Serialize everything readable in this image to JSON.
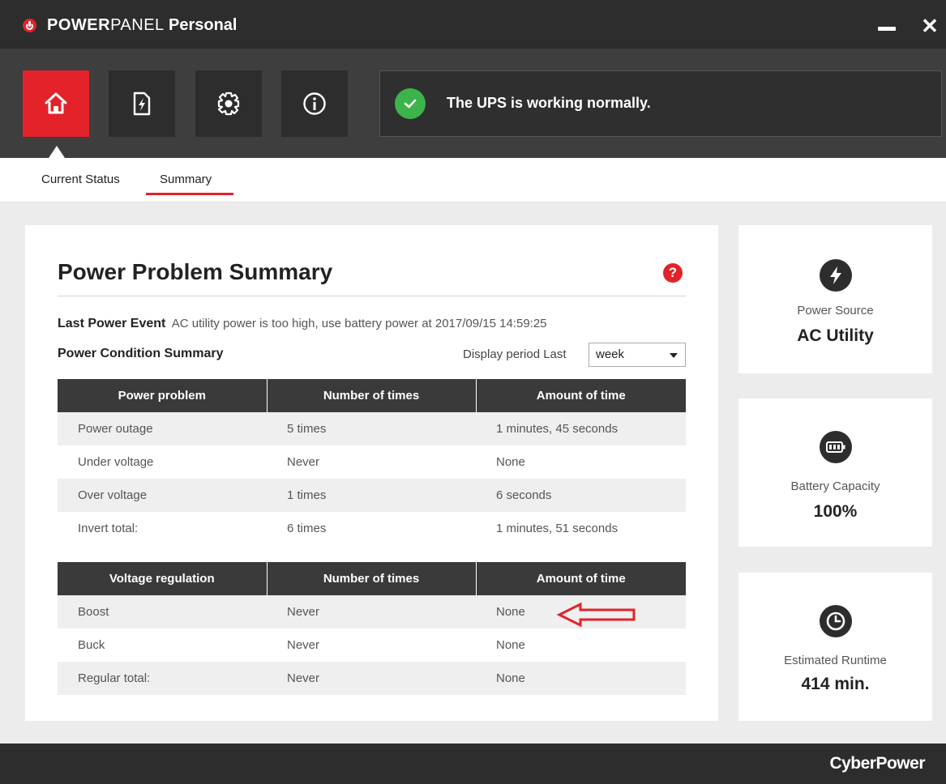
{
  "app": {
    "title_part1": "POWER",
    "title_part2": "PANEL",
    "title_part3": "Personal",
    "accent": "#e3222a"
  },
  "window_controls": {
    "minimize_icon": "minimize-icon",
    "close_label": "✕"
  },
  "nav": {
    "items": [
      {
        "name": "home",
        "icon": "home-icon",
        "active": true
      },
      {
        "name": "energy",
        "icon": "power-file-icon",
        "active": false
      },
      {
        "name": "settings",
        "icon": "gear-icon",
        "active": false
      },
      {
        "name": "info",
        "icon": "info-icon",
        "active": false
      }
    ]
  },
  "status": {
    "message": "The UPS is working normally.",
    "icon": "check-icon",
    "color": "#3cb44b"
  },
  "tabs": [
    {
      "label": "Current Status",
      "active": false
    },
    {
      "label": "Summary",
      "active": true
    }
  ],
  "summary": {
    "title": "Power Problem Summary",
    "help": "?",
    "last_event_label": "Last Power Event",
    "last_event_value": "AC utility power is too high, use battery power at 2017/09/15 14:59:25",
    "condition_title": "Power Condition Summary",
    "period_label": "Display period Last",
    "period_value": "week",
    "power_table": {
      "headers": [
        "Power problem",
        "Number of times",
        "Amount of time"
      ],
      "rows": [
        [
          "Power outage",
          "5 times",
          "1 minutes, 45 seconds"
        ],
        [
          "Under voltage",
          "Never",
          "None"
        ],
        [
          "Over voltage",
          "1 times",
          "6 seconds"
        ],
        [
          "Invert total:",
          "6 times",
          "1 minutes, 51 seconds"
        ]
      ]
    },
    "voltage_table": {
      "headers": [
        "Voltage regulation",
        "Number of times",
        "Amount of time"
      ],
      "rows": [
        [
          "Boost",
          "Never",
          "None"
        ],
        [
          "Buck",
          "Never",
          "None"
        ],
        [
          "Regular total:",
          "Never",
          "None"
        ]
      ]
    }
  },
  "cards": {
    "power_source": {
      "label": "Power Source",
      "value": "AC Utility",
      "icon": "lightning-icon"
    },
    "battery": {
      "label": "Battery Capacity",
      "value": "100%",
      "icon": "battery-icon"
    },
    "runtime": {
      "label": "Estimated Runtime",
      "value": "414 min.",
      "icon": "clock-icon"
    }
  },
  "footer": {
    "brand": "CyberPower"
  }
}
